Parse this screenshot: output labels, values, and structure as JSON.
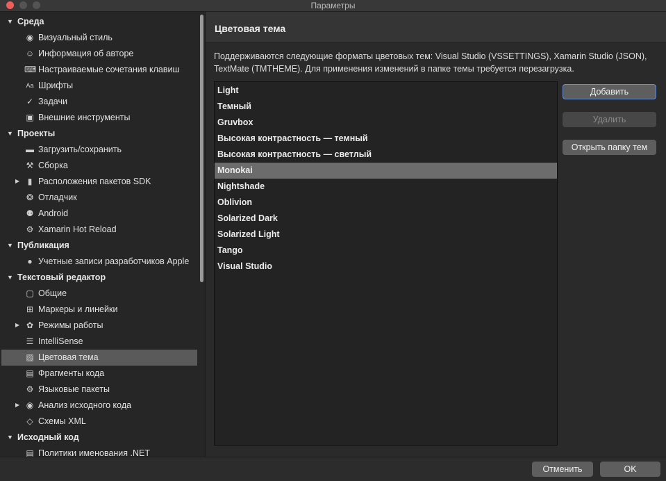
{
  "window": {
    "title": "Параметры"
  },
  "sidebar": {
    "categories": [
      {
        "label": "Среда",
        "items": [
          {
            "label": "Визуальный стиль",
            "icon": "eye-icon"
          },
          {
            "label": "Информация об авторе",
            "icon": "smiley-icon"
          },
          {
            "label": "Настраиваемые сочетания клавиш",
            "icon": "keyboard-icon"
          },
          {
            "label": "Шрифты",
            "icon": "font-icon",
            "icon_text": "Aa"
          },
          {
            "label": "Задачи",
            "icon": "checkmark-icon"
          },
          {
            "label": "Внешние инструменты",
            "icon": "terminal-icon"
          }
        ]
      },
      {
        "label": "Проекты",
        "items": [
          {
            "label": "Загрузить/сохранить",
            "icon": "disk-icon"
          },
          {
            "label": "Сборка",
            "icon": "hammer-icon"
          },
          {
            "label": "Расположения пакетов SDK",
            "icon": "folder-icon",
            "expandable": true
          },
          {
            "label": "Отладчик",
            "icon": "bug-icon"
          },
          {
            "label": "Android",
            "icon": "android-icon"
          },
          {
            "label": "Xamarin Hot Reload",
            "icon": "gear-icon"
          }
        ]
      },
      {
        "label": "Публикация",
        "items": [
          {
            "label": "Учетные записи разработчиков Apple",
            "icon": "apple-icon"
          }
        ]
      },
      {
        "label": "Текстовый редактор",
        "items": [
          {
            "label": "Общие",
            "icon": "edit-icon"
          },
          {
            "label": "Маркеры и линейки",
            "icon": "grid-icon"
          },
          {
            "label": "Режимы работы",
            "icon": "palette-icon",
            "expandable": true
          },
          {
            "label": "IntelliSense",
            "icon": "list-icon"
          },
          {
            "label": "Цветовая тема",
            "icon": "color-theme-icon",
            "selected": true
          },
          {
            "label": "Фрагменты кода",
            "icon": "snippet-icon"
          },
          {
            "label": "Языковые пакеты",
            "icon": "gear-icon"
          },
          {
            "label": "Анализ исходного кода",
            "icon": "radio-icon",
            "expandable": true
          },
          {
            "label": "Схемы XML",
            "icon": "xml-icon"
          }
        ]
      },
      {
        "label": "Исходный код",
        "items": [
          {
            "label": "Политики именования .NET",
            "icon": "document-icon"
          }
        ]
      }
    ]
  },
  "main": {
    "title": "Цветовая тема",
    "description": "Поддерживаются следующие форматы цветовых тем: Visual Studio (VSSETTINGS), Xamarin Studio (JSON), TextMate (TMTHEME). Для применения изменений в папке темы требуется перезагрузка.",
    "themes": [
      "Light",
      "Темный",
      "Gruvbox",
      "Высокая контрастность — темный",
      "Высокая контрастность — светлый",
      "Monokai",
      "Nightshade",
      "Oblivion",
      "Solarized Dark",
      "Solarized Light",
      "Tango",
      "Visual Studio"
    ],
    "selected_theme": "Monokai",
    "buttons": {
      "add": "Добавить",
      "remove": "Удалить",
      "open_folder": "Открыть папку тем"
    }
  },
  "footer": {
    "cancel": "Отменить",
    "ok": "OK"
  },
  "colors": {
    "selection": "#6c6c6c",
    "sidebar_selection": "#5a5a5a",
    "focus_ring": "#6a8fd0",
    "close": "#ec5f5a"
  }
}
